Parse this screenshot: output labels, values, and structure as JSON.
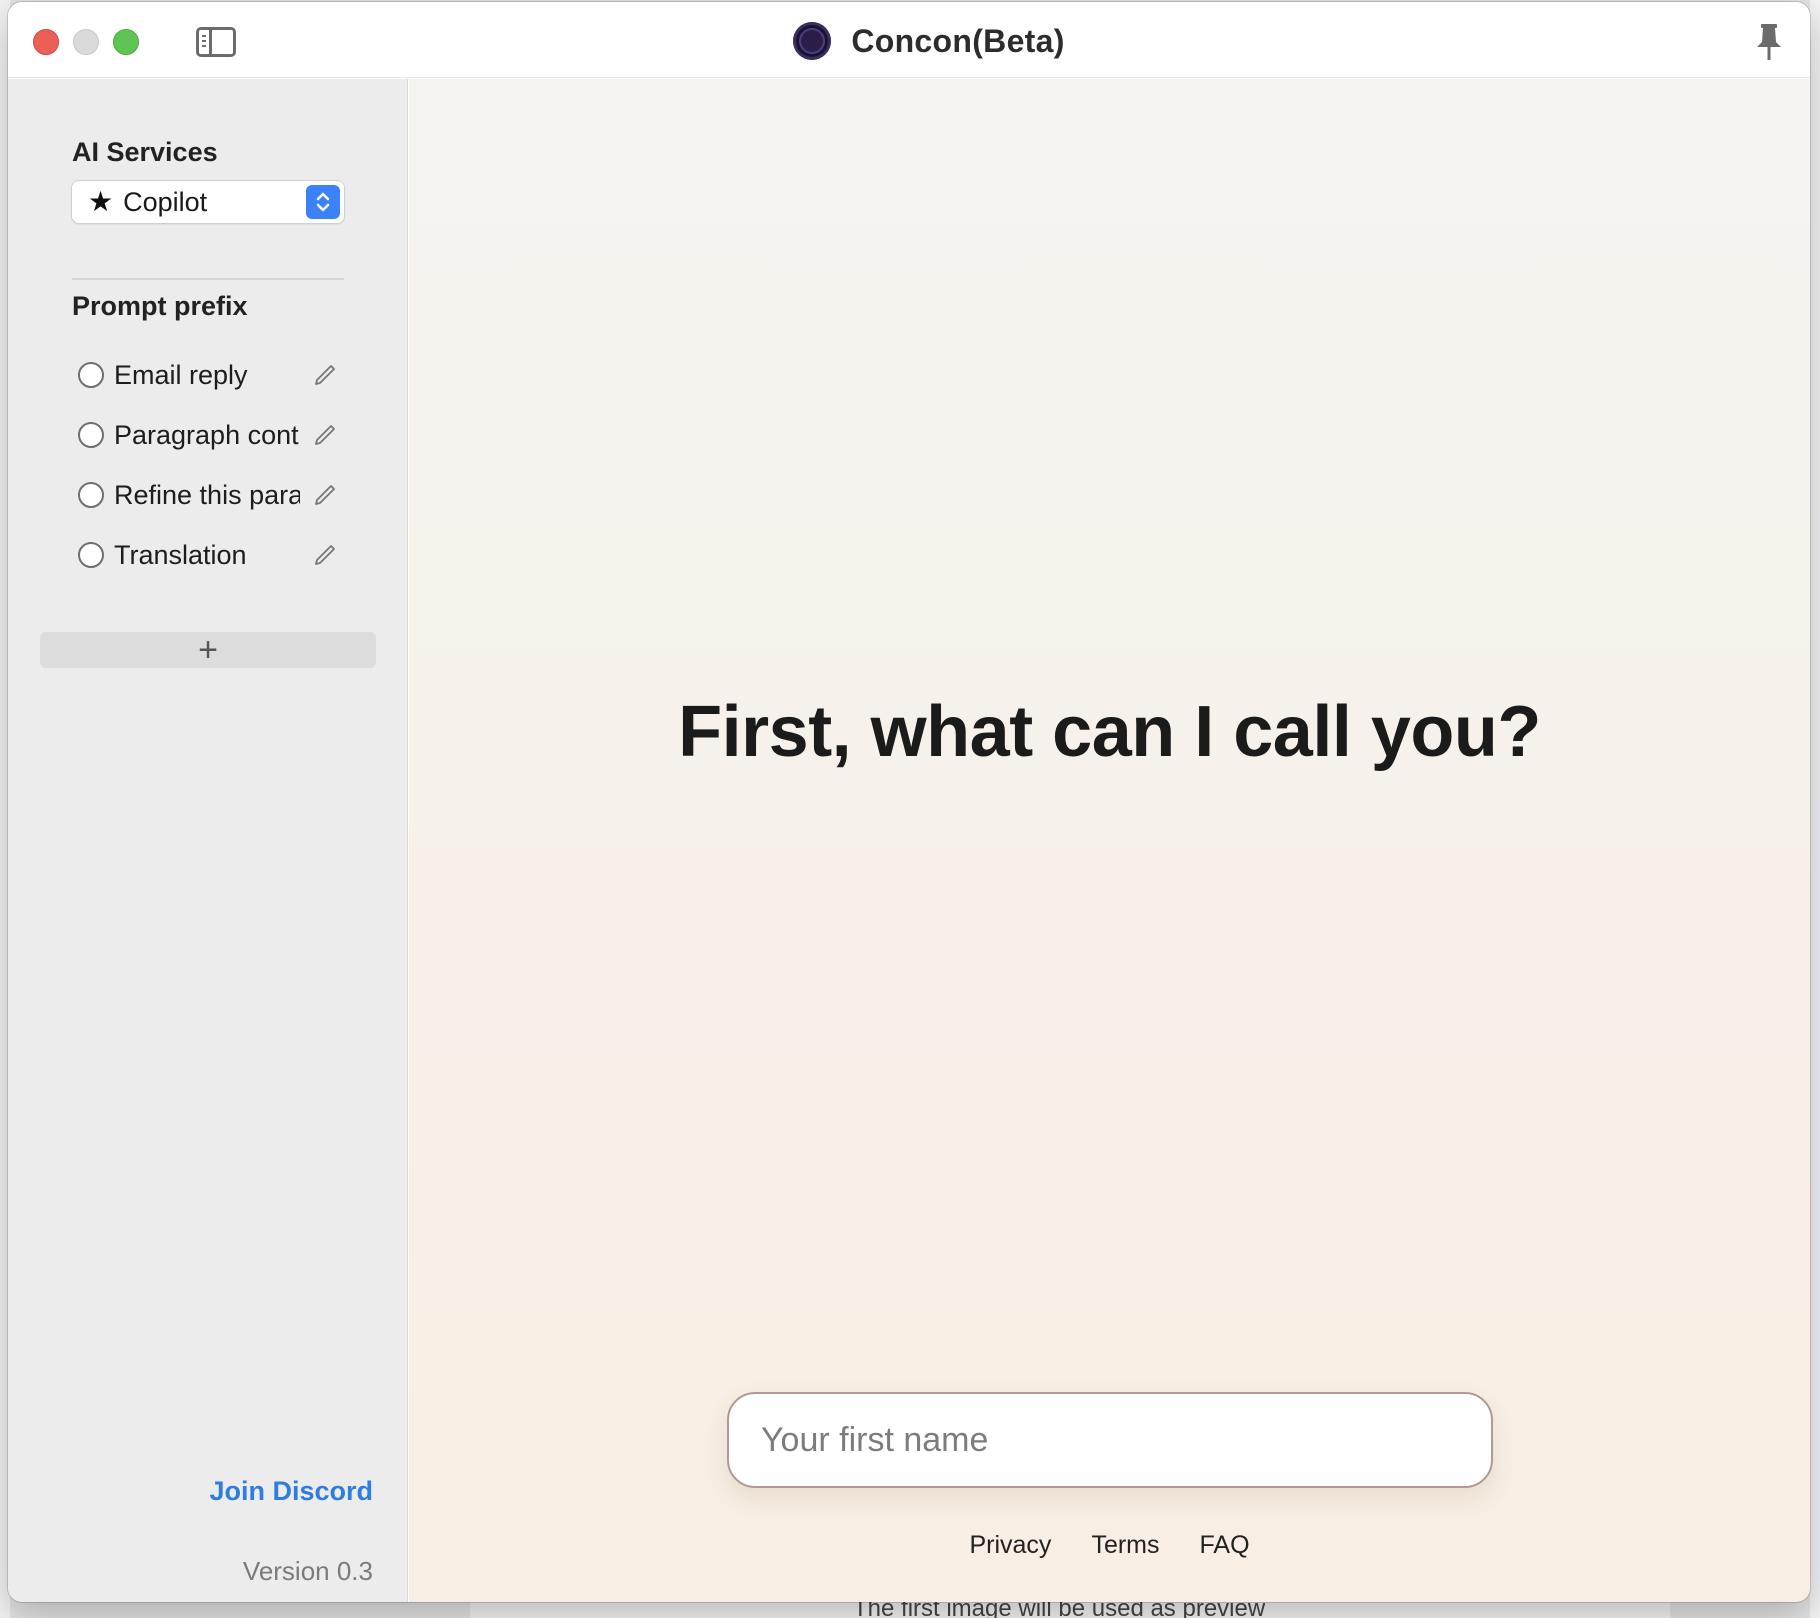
{
  "window": {
    "title": "Concon(Beta)"
  },
  "sidebar": {
    "ai_services_heading": "AI Services",
    "ai_service_selected": "Copilot",
    "prompt_prefix_heading": "Prompt prefix",
    "prefixes": [
      {
        "label": "Email reply",
        "selected": false
      },
      {
        "label": "Paragraph cont",
        "selected": false
      },
      {
        "label": "Refine this para",
        "selected": false
      },
      {
        "label": "Translation",
        "selected": false
      }
    ],
    "add_symbol": "+",
    "join_discord": "Join Discord",
    "version": "Version 0.3"
  },
  "main": {
    "headline": "First, what can I call you?",
    "name_input_placeholder": "Your first name",
    "footer_links": [
      "Privacy",
      "Terms",
      "FAQ"
    ]
  },
  "background": {
    "partial_text": "The first image will be used as preview"
  },
  "colors": {
    "accent_blue": "#3a82f6",
    "link_blue": "#2f7de1",
    "close": "#ec5f57",
    "maximize": "#5fc453"
  },
  "icons": [
    "app-logo-icon",
    "sidebar-toggle-icon",
    "pin-icon",
    "star-icon",
    "chevron-updown-icon",
    "pencil-icon",
    "plus-icon"
  ]
}
